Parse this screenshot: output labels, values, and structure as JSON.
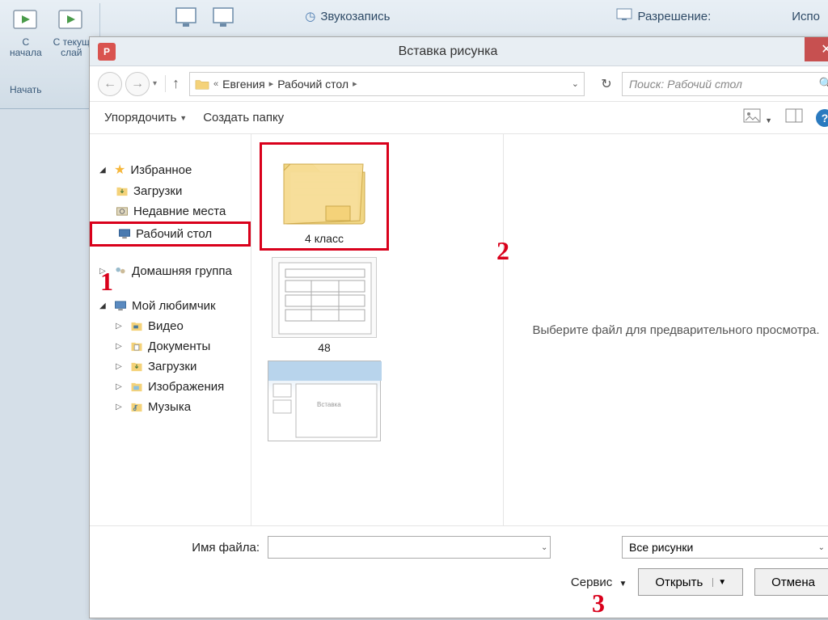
{
  "ribbon": {
    "start_btn1": "С\nначала",
    "start_btn2": "С текущ\nслай",
    "footer": "Начать",
    "audio": "Звукозапись",
    "resolution": "Разрешение:",
    "use": "Испо"
  },
  "dialog": {
    "title": "Вставка рисунка",
    "breadcrumb": {
      "sep_dbl": "«",
      "p1": "Евгения",
      "p2": "Рабочий стол"
    },
    "search_placeholder": "Поиск: Рабочий стол",
    "organize": "Упорядочить",
    "new_folder": "Создать папку",
    "tree": {
      "favorites": "Избранное",
      "downloads": "Загрузки",
      "recent": "Недавние места",
      "desktop": "Рабочий стол",
      "homegroup": "Домашняя группа",
      "computer": "Мой любимчик",
      "video": "Видео",
      "documents": "Документы",
      "downloads2": "Загрузки",
      "images": "Изображения",
      "music": "Музыка"
    },
    "files": {
      "folder1": "4 класс",
      "file2": "48"
    },
    "preview": "Выберите файл для предварительного просмотра.",
    "footer": {
      "filename_label": "Имя файла:",
      "filter": "Все рисунки",
      "service": "Сервис",
      "open": "Открыть",
      "cancel": "Отмена"
    }
  },
  "annotations": {
    "a1": "1",
    "a2": "2",
    "a3": "3"
  }
}
